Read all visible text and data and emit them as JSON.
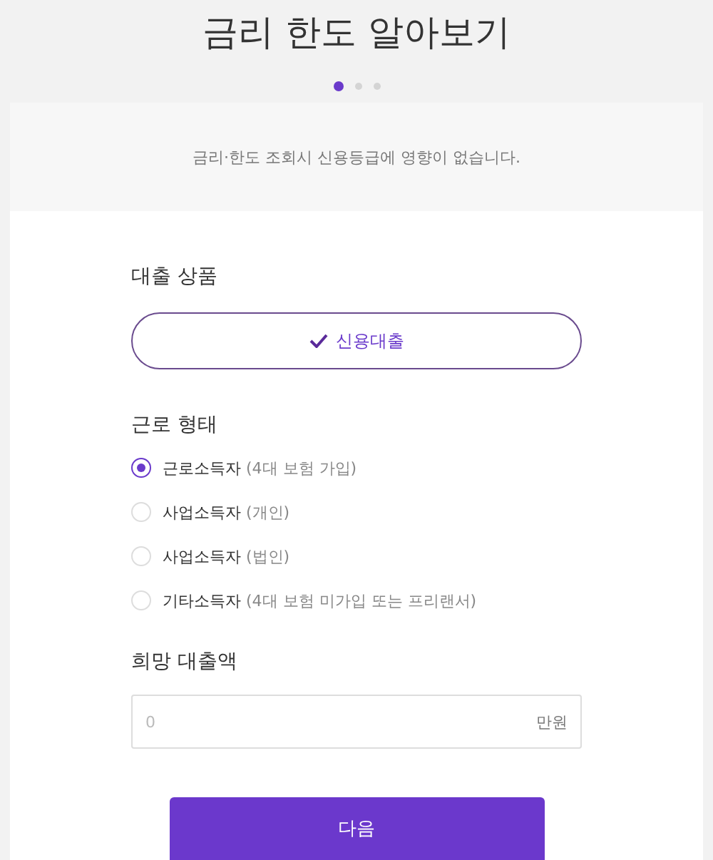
{
  "title": "금리 한도 알아보기",
  "steps": [
    {
      "selected": true
    },
    {
      "selected": false
    },
    {
      "selected": false
    }
  ],
  "notice": "금리·한도 조회시 신용등급에 영향이 없습니다.",
  "loan_product": {
    "label": "대출 상품",
    "option": {
      "text": "신용대출",
      "selected": true
    }
  },
  "employment": {
    "label": "근로 형태",
    "options": [
      {
        "label": "근로소득자",
        "note": "(4대 보험 가입)",
        "selected": true
      },
      {
        "label": "사업소득자",
        "note": "(개인)",
        "selected": false
      },
      {
        "label": "사업소득자",
        "note": "(법인)",
        "selected": false
      },
      {
        "label": "기타소득자",
        "note": "(4대 보험 미가입 또는 프리랜서)",
        "selected": false
      }
    ]
  },
  "amount": {
    "label": "희망 대출액",
    "placeholder": "0",
    "unit": "만원"
  },
  "next_button": "다음"
}
